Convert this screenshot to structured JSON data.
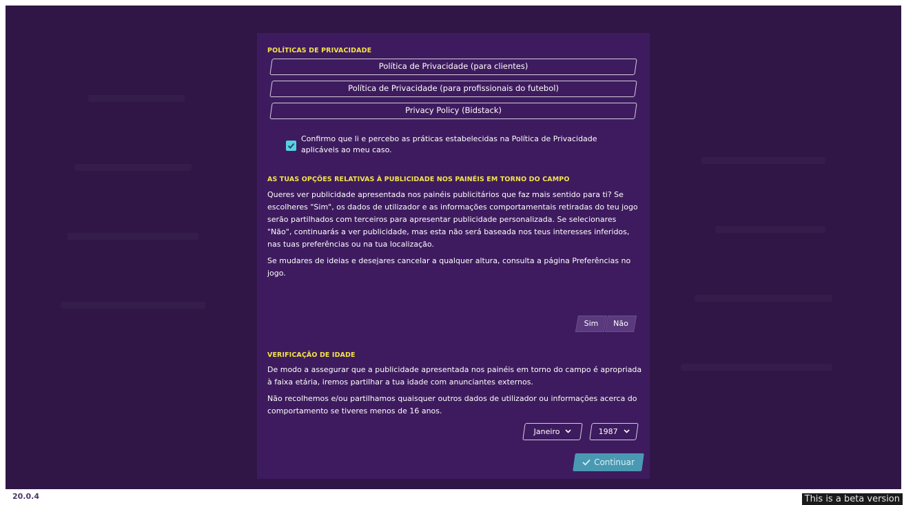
{
  "app": {
    "version": "20.0.4",
    "beta_notice": "This is a beta version"
  },
  "privacy": {
    "title": "POLÍTICAS DE PRIVACIDADE",
    "buttons": [
      "Política de Privacidade (para clientes)",
      "Política de Privacidade (para profissionais do futebol)",
      "Privacy Policy (Bidstack)"
    ],
    "consent_checked": true,
    "consent_label": "Confirmo que li e percebo as práticas estabelecidas na Política de Privacidade aplicáveis ao meu caso."
  },
  "ads": {
    "title": "AS TUAS OPÇÕES RELATIVAS À PUBLICIDADE NOS PAINÉIS EM TORNO DO CAMPO",
    "paragraph1": "Queres ver publicidade apresentada nos painéis publicitários que faz mais sentido para ti? Se escolheres \"Sim\", os dados de utilizador e as informações comportamentais retiradas do teu jogo serão partilhados com terceiros para apresentar publicidade personalizada. Se selecionares \"Não\", continuarás a ver publicidade, mas esta não será baseada nos teus interesses inferidos, nas tuas preferências ou na tua localização.",
    "paragraph2": "Se mudares de ideias e desejares cancelar a qualquer altura, consulta a página Preferências no jogo.",
    "yes_label": "Sim",
    "no_label": "Não"
  },
  "age": {
    "title": "VERIFICAÇÃO DE IDADE",
    "paragraph1": "De modo a assegurar que a publicidade apresentada nos painéis em torno do campo é apropriada à faixa etária, iremos partilhar a tua idade com anunciantes externos.",
    "paragraph2": "Não recolhemos e/ou partilhamos quaisquer outros dados de utilizador ou informações acerca do comportamento se tiveres menos de 16 anos.",
    "month": "Janeiro",
    "year": "1987"
  },
  "actions": {
    "continue_label": "Continuar"
  },
  "colors": {
    "background": "#2f1646",
    "modal": "#3e1b5e",
    "section_title": "#f3e34a",
    "checkbox": "#57d0e2",
    "continue": "#4a99b2"
  }
}
